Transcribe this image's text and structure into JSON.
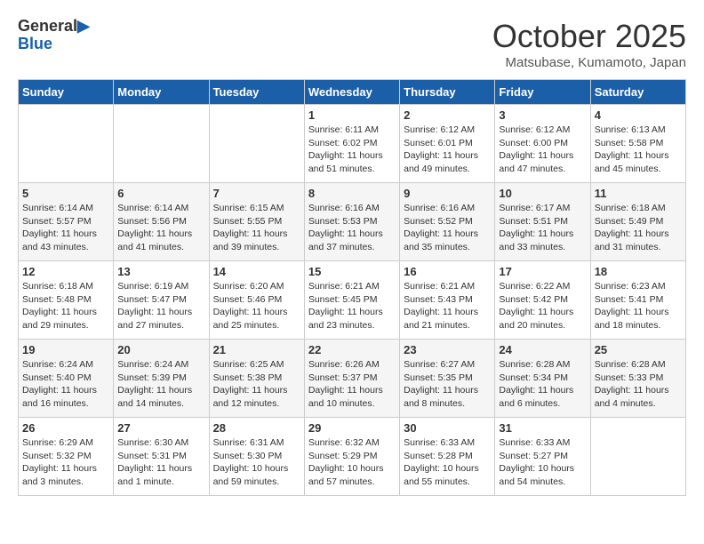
{
  "header": {
    "logo_line1": "General",
    "logo_line2": "Blue",
    "month": "October 2025",
    "location": "Matsubase, Kumamoto, Japan"
  },
  "days_of_week": [
    "Sunday",
    "Monday",
    "Tuesday",
    "Wednesday",
    "Thursday",
    "Friday",
    "Saturday"
  ],
  "weeks": [
    [
      {
        "day": "",
        "info": ""
      },
      {
        "day": "",
        "info": ""
      },
      {
        "day": "",
        "info": ""
      },
      {
        "day": "1",
        "info": "Sunrise: 6:11 AM\nSunset: 6:02 PM\nDaylight: 11 hours\nand 51 minutes."
      },
      {
        "day": "2",
        "info": "Sunrise: 6:12 AM\nSunset: 6:01 PM\nDaylight: 11 hours\nand 49 minutes."
      },
      {
        "day": "3",
        "info": "Sunrise: 6:12 AM\nSunset: 6:00 PM\nDaylight: 11 hours\nand 47 minutes."
      },
      {
        "day": "4",
        "info": "Sunrise: 6:13 AM\nSunset: 5:58 PM\nDaylight: 11 hours\nand 45 minutes."
      }
    ],
    [
      {
        "day": "5",
        "info": "Sunrise: 6:14 AM\nSunset: 5:57 PM\nDaylight: 11 hours\nand 43 minutes."
      },
      {
        "day": "6",
        "info": "Sunrise: 6:14 AM\nSunset: 5:56 PM\nDaylight: 11 hours\nand 41 minutes."
      },
      {
        "day": "7",
        "info": "Sunrise: 6:15 AM\nSunset: 5:55 PM\nDaylight: 11 hours\nand 39 minutes."
      },
      {
        "day": "8",
        "info": "Sunrise: 6:16 AM\nSunset: 5:53 PM\nDaylight: 11 hours\nand 37 minutes."
      },
      {
        "day": "9",
        "info": "Sunrise: 6:16 AM\nSunset: 5:52 PM\nDaylight: 11 hours\nand 35 minutes."
      },
      {
        "day": "10",
        "info": "Sunrise: 6:17 AM\nSunset: 5:51 PM\nDaylight: 11 hours\nand 33 minutes."
      },
      {
        "day": "11",
        "info": "Sunrise: 6:18 AM\nSunset: 5:49 PM\nDaylight: 11 hours\nand 31 minutes."
      }
    ],
    [
      {
        "day": "12",
        "info": "Sunrise: 6:18 AM\nSunset: 5:48 PM\nDaylight: 11 hours\nand 29 minutes."
      },
      {
        "day": "13",
        "info": "Sunrise: 6:19 AM\nSunset: 5:47 PM\nDaylight: 11 hours\nand 27 minutes."
      },
      {
        "day": "14",
        "info": "Sunrise: 6:20 AM\nSunset: 5:46 PM\nDaylight: 11 hours\nand 25 minutes."
      },
      {
        "day": "15",
        "info": "Sunrise: 6:21 AM\nSunset: 5:45 PM\nDaylight: 11 hours\nand 23 minutes."
      },
      {
        "day": "16",
        "info": "Sunrise: 6:21 AM\nSunset: 5:43 PM\nDaylight: 11 hours\nand 21 minutes."
      },
      {
        "day": "17",
        "info": "Sunrise: 6:22 AM\nSunset: 5:42 PM\nDaylight: 11 hours\nand 20 minutes."
      },
      {
        "day": "18",
        "info": "Sunrise: 6:23 AM\nSunset: 5:41 PM\nDaylight: 11 hours\nand 18 minutes."
      }
    ],
    [
      {
        "day": "19",
        "info": "Sunrise: 6:24 AM\nSunset: 5:40 PM\nDaylight: 11 hours\nand 16 minutes."
      },
      {
        "day": "20",
        "info": "Sunrise: 6:24 AM\nSunset: 5:39 PM\nDaylight: 11 hours\nand 14 minutes."
      },
      {
        "day": "21",
        "info": "Sunrise: 6:25 AM\nSunset: 5:38 PM\nDaylight: 11 hours\nand 12 minutes."
      },
      {
        "day": "22",
        "info": "Sunrise: 6:26 AM\nSunset: 5:37 PM\nDaylight: 11 hours\nand 10 minutes."
      },
      {
        "day": "23",
        "info": "Sunrise: 6:27 AM\nSunset: 5:35 PM\nDaylight: 11 hours\nand 8 minutes."
      },
      {
        "day": "24",
        "info": "Sunrise: 6:28 AM\nSunset: 5:34 PM\nDaylight: 11 hours\nand 6 minutes."
      },
      {
        "day": "25",
        "info": "Sunrise: 6:28 AM\nSunset: 5:33 PM\nDaylight: 11 hours\nand 4 minutes."
      }
    ],
    [
      {
        "day": "26",
        "info": "Sunrise: 6:29 AM\nSunset: 5:32 PM\nDaylight: 11 hours\nand 3 minutes."
      },
      {
        "day": "27",
        "info": "Sunrise: 6:30 AM\nSunset: 5:31 PM\nDaylight: 11 hours\nand 1 minute."
      },
      {
        "day": "28",
        "info": "Sunrise: 6:31 AM\nSunset: 5:30 PM\nDaylight: 10 hours\nand 59 minutes."
      },
      {
        "day": "29",
        "info": "Sunrise: 6:32 AM\nSunset: 5:29 PM\nDaylight: 10 hours\nand 57 minutes."
      },
      {
        "day": "30",
        "info": "Sunrise: 6:33 AM\nSunset: 5:28 PM\nDaylight: 10 hours\nand 55 minutes."
      },
      {
        "day": "31",
        "info": "Sunrise: 6:33 AM\nSunset: 5:27 PM\nDaylight: 10 hours\nand 54 minutes."
      },
      {
        "day": "",
        "info": ""
      }
    ]
  ]
}
